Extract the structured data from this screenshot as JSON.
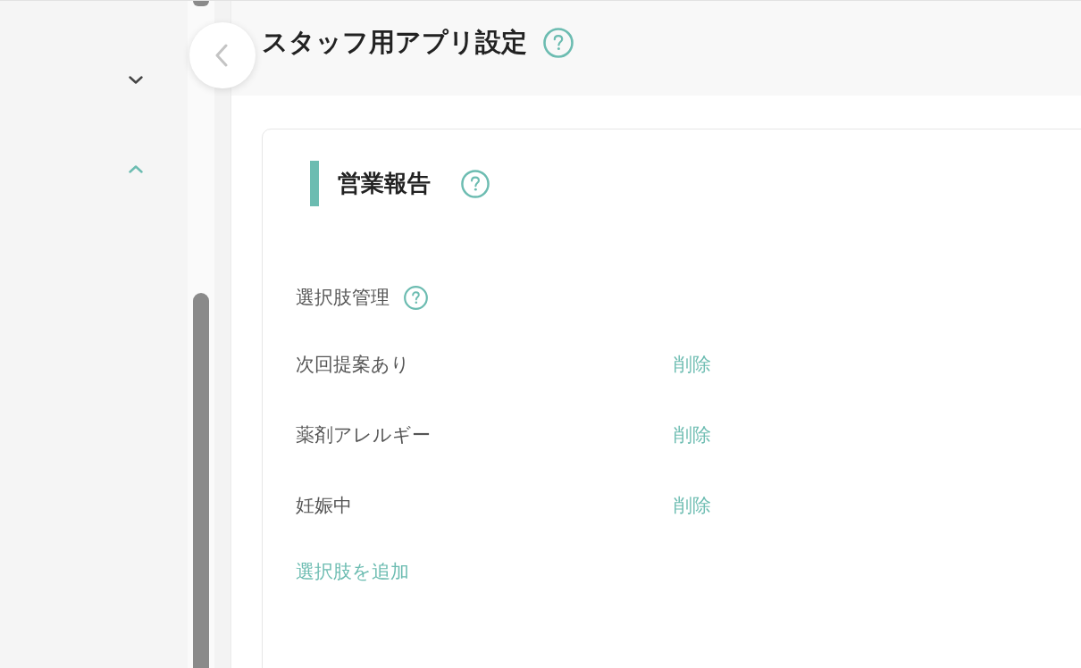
{
  "sidebar": {
    "sections": [
      {
        "expanded": false
      },
      {
        "expanded": true
      }
    ]
  },
  "header": {
    "title": "スタッフ用アプリ設定"
  },
  "section": {
    "title": "営業報告",
    "choices": {
      "label": "選択肢管理",
      "items": [
        {
          "label": "次回提案あり",
          "action": "削除"
        },
        {
          "label": "薬剤アレルギー",
          "action": "削除"
        },
        {
          "label": "妊娠中",
          "action": "削除"
        }
      ],
      "add_link": "選択肢を追加"
    }
  }
}
